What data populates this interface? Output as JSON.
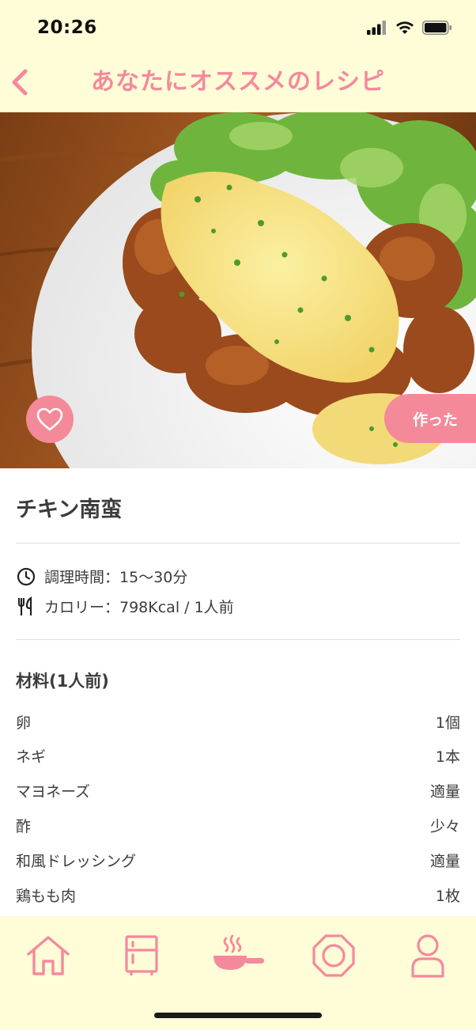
{
  "status_bar": {
    "time": "20:26"
  },
  "nav": {
    "title": "あなたにオススメのレシピ"
  },
  "hero": {
    "made_label": "作った"
  },
  "recipe": {
    "name": "チキン南蛮",
    "cook_time": "調理時間：15〜30分",
    "calories": "カロリー：798Kcal / 1人前"
  },
  "ingredients": {
    "title": "材料(1人前)",
    "items": [
      {
        "name": "卵",
        "qty": "1個"
      },
      {
        "name": "ネギ",
        "qty": "1本"
      },
      {
        "name": "マヨネーズ",
        "qty": "適量"
      },
      {
        "name": "酢",
        "qty": "少々"
      },
      {
        "name": "和風ドレッシング",
        "qty": "適量"
      },
      {
        "name": "鶏もも肉",
        "qty": "1枚"
      }
    ]
  },
  "colors": {
    "accent": "#f5899c",
    "header_bg": "#fefdd8"
  },
  "tabs": [
    "home-icon",
    "fridge-icon",
    "cooking-pan-icon",
    "octagon-icon",
    "profile-icon"
  ]
}
